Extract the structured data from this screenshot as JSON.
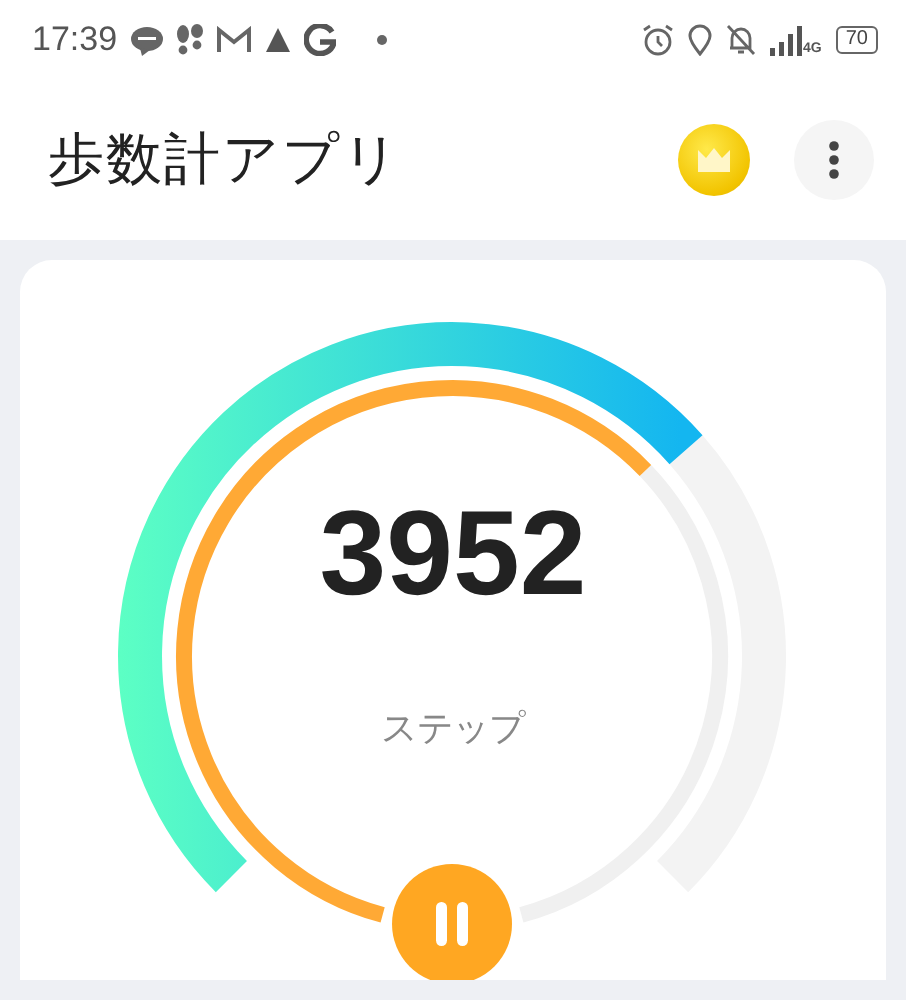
{
  "status_bar": {
    "time": "17:39",
    "network": "4G",
    "battery": "70"
  },
  "app_bar": {
    "title": "歩数計アプリ"
  },
  "gauge": {
    "steps": "3952",
    "unit": "ステップ",
    "paused": false
  }
}
